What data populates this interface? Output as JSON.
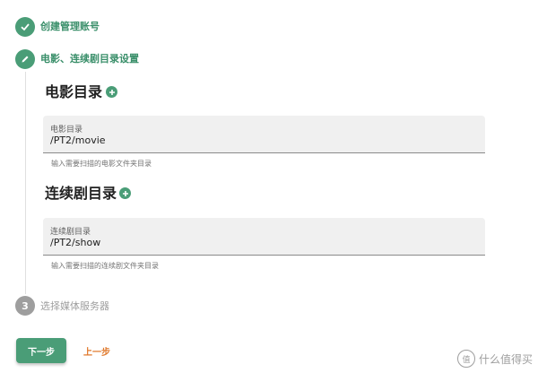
{
  "steps": [
    {
      "label": "创建管理账号",
      "state": "done"
    },
    {
      "label": "电影、连续剧目录设置",
      "state": "active"
    },
    {
      "number": "3",
      "label": "选择媒体服务器",
      "state": "pending"
    }
  ],
  "movie": {
    "title": "电影目录",
    "field_label": "电影目录",
    "field_value": "/PT2/movie",
    "hint": "输入需要扫描的电影文件夹目录"
  },
  "tv": {
    "title": "连续剧目录",
    "field_label": "连续剧目录",
    "field_value": "/PT2/show",
    "hint": "输入需要扫描的连续剧文件夹目录"
  },
  "buttons": {
    "next": "下一步",
    "prev": "上一步"
  },
  "watermark": {
    "text": "什么值得买",
    "mark": "值"
  },
  "colors": {
    "accent": "#4a9d77",
    "link": "#e07a2e",
    "inactive": "#9e9e9e"
  }
}
